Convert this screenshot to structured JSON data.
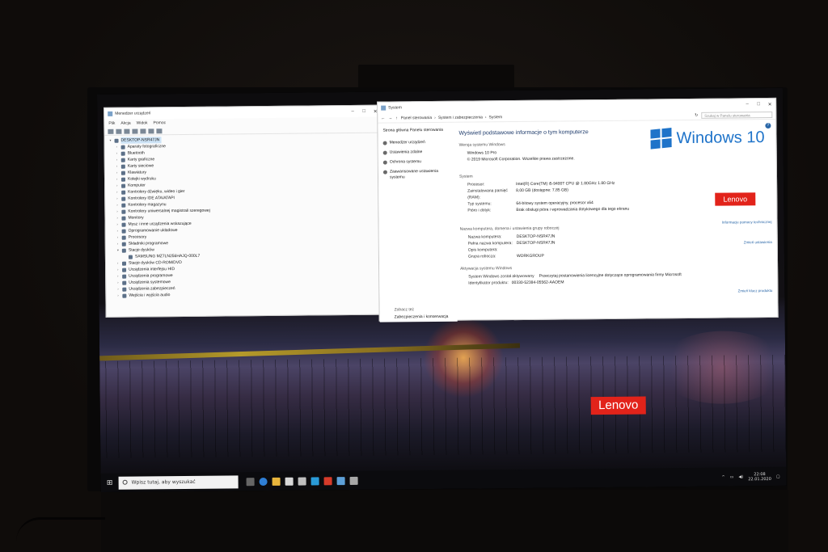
{
  "device_manager": {
    "title": "Menedżer urządzeń",
    "menu": [
      "Plik",
      "Akcja",
      "Widok",
      "Pomoc"
    ],
    "root": "DESKTOP-NSR47JN",
    "items": [
      {
        "label": "Aparaty fotograficzne"
      },
      {
        "label": "Bluetooth"
      },
      {
        "label": "Karty graficzne"
      },
      {
        "label": "Karty sieciowe"
      },
      {
        "label": "Klawiatury"
      },
      {
        "label": "Kolejki wydruku"
      },
      {
        "label": "Komputer"
      },
      {
        "label": "Kontrolery dźwięku, wideo i gier"
      },
      {
        "label": "Kontrolery IDE ATA/ATAPI"
      },
      {
        "label": "Kontrolery magazynu"
      },
      {
        "label": "Kontrolery uniwersalnej magistrali szeregowej"
      },
      {
        "label": "Monitory"
      },
      {
        "label": "Mysz i inne urządzenia wskazujące"
      },
      {
        "label": "Oprogramowanie układowe"
      },
      {
        "label": "Procesory"
      },
      {
        "label": "Składniki programowe"
      },
      {
        "label": "Stacje dysków"
      },
      {
        "label": "SAMSUNG MZ7LN256HAJQ-000L7",
        "child": true
      },
      {
        "label": "Stacje dysków CD-ROM/DVD"
      },
      {
        "label": "Urządzenia interfejsu HID"
      },
      {
        "label": "Urządzenia programowe"
      },
      {
        "label": "Urządzenia systemowe"
      },
      {
        "label": "Urządzenia zabezpieczeń"
      },
      {
        "label": "Wejścia i wyjścia audio"
      }
    ]
  },
  "system": {
    "title": "System",
    "breadcrumb": [
      "Panel sterowania",
      "System i zabezpieczenia",
      "System"
    ],
    "search_placeholder": "Szukaj w Panelu sterowania",
    "left_home": "Strona główna Panelu sterowania",
    "left_links": [
      "Menedżer urządzeń",
      "Ustawienia zdalne",
      "Ochrona systemu",
      "Zaawansowane ustawienia systemu"
    ],
    "see_also": "Zobacz też",
    "security_link": "Zabezpieczenia i konserwacja",
    "heading": "Wyświetl podstawowe informacje o tym komputerze",
    "edition_section": "Wersja systemu Windows",
    "edition": "Windows 10 Pro",
    "copyright": "© 2019 Microsoft Corporation. Wszelkie prawa zastrzeżone.",
    "logo_text": "Windows 10",
    "oem_logo": "Lenovo",
    "system_section": "System",
    "system_rows": [
      {
        "k": "Procesor:",
        "v": "Intel(R) Core(TM) i5-9400T CPU @ 1.80GHz   1.80 GHz"
      },
      {
        "k": "Zainstalowana pamięć (RAM):",
        "v": "8,00 GB (dostępne: 7,85 GB)"
      },
      {
        "k": "Typ systemu:",
        "v": "64-bitowy system operacyjny, procesor x64"
      },
      {
        "k": "Pióro i dotyk:",
        "v": "Brak obsługi pióra i wprowadzania dotykowego dla tego ekranu"
      }
    ],
    "support_link": "Informacje pomocy technicznej",
    "name_section": "Nazwa komputera, domena i ustawienia grupy roboczej",
    "name_rows": [
      {
        "k": "Nazwa komputera:",
        "v": "DESKTOP-NSR47JN"
      },
      {
        "k": "Pełna nazwa komputera:",
        "v": "DESKTOP-NSR47JN"
      },
      {
        "k": "Opis komputera:",
        "v": ""
      },
      {
        "k": "Grupa robocza:",
        "v": "WORKGROUP"
      }
    ],
    "change_settings": "Zmień ustawienia",
    "activation_section": "Aktywacja systemu Windows",
    "activation_status": "System Windows został aktywowany",
    "license_link": "Przeczytaj postanowienia licencyjne dotyczące oprogramowania firmy Microsoft",
    "product_id_label": "Identyfikator produktu:",
    "product_id": "00330-52384-05562-AAOEM",
    "change_key": "Zmień klucz produktu"
  },
  "wallpaper": {
    "logo": "Lenovo"
  },
  "taskbar": {
    "search_placeholder": "Wpisz tutaj, aby wyszukać",
    "time": "22:08",
    "date": "22.01.2020"
  },
  "colors": {
    "accent": "#1e73c9",
    "lenovo": "#e2231a"
  }
}
